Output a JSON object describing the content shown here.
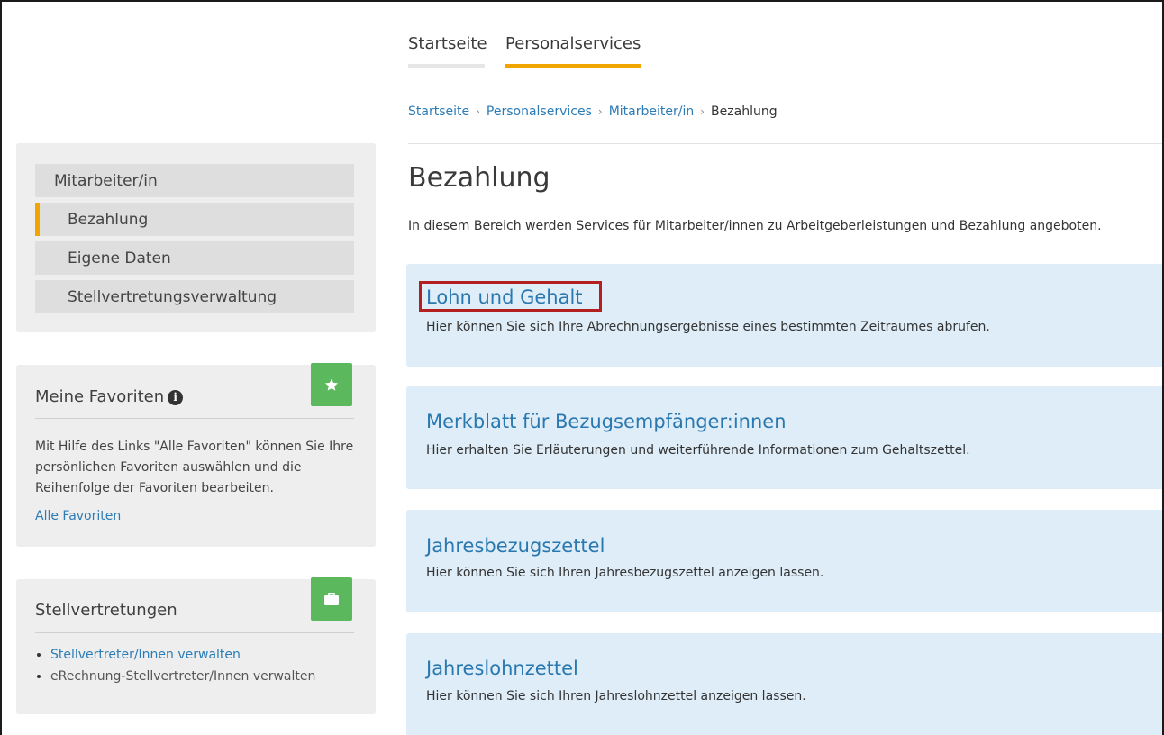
{
  "top_tabs": [
    {
      "label": "Startseite",
      "active": false
    },
    {
      "label": "Personalservices",
      "active": true
    }
  ],
  "breadcrumb": [
    "Startseite",
    "Personalservices",
    "Mitarbeiter/in",
    "Bezahlung"
  ],
  "breadcrumb_separator": "›",
  "sidebar": {
    "nav": {
      "parent": "Mitarbeiter/in",
      "children": [
        "Bezahlung",
        "Eigene Daten",
        "Stellvertretungsverwaltung"
      ],
      "active": "Bezahlung"
    },
    "favorites": {
      "title": "Meine Favoriten",
      "icon": "star-icon",
      "text": "Mit Hilfe des Links \"Alle Favoriten\" können Sie Ihre persönlichen Favoriten auswählen und die Reihenfolge der Favoriten bearbeiten.",
      "link": "Alle Favoriten"
    },
    "deputies": {
      "title": "Stellvertretungen",
      "icon": "briefcase-icon",
      "items": [
        "Stellvertreter/Innen verwalten",
        "eRechnung-Stellvertreter/Innen verwalten"
      ]
    }
  },
  "main": {
    "title": "Bezahlung",
    "intro": "In diesem Bereich werden Services für Mitarbeiter/innen zu Arbeitgeberleistungen und Bezahlung angeboten.",
    "cards": [
      {
        "title": "Lohn und Gehalt",
        "description": "Hier können Sie sich Ihre Abrechnungsergebnisse eines bestimmten Zeitraumes abrufen."
      },
      {
        "title": "Merkblatt für Bezugsempfänger:innen",
        "description": "Hier erhalten Sie Erläuterungen und weiterführende Informationen zum Gehaltszettel."
      },
      {
        "title": "Jahresbezugszettel",
        "description": "Hier können Sie sich Ihren Jahresbezugszettel anzeigen lassen."
      },
      {
        "title": "Jahreslohnzettel",
        "description": "Hier können Sie sich Ihren Jahreslohnzettel anzeigen lassen."
      }
    ]
  },
  "colors": {
    "accent": "#f0a500",
    "tab_inactive_underline": "#e6e6e6",
    "link": "#2b7cb6",
    "card_background": "#deedf7",
    "badge_green": "#5cb85c",
    "highlight": "#b3201f"
  }
}
